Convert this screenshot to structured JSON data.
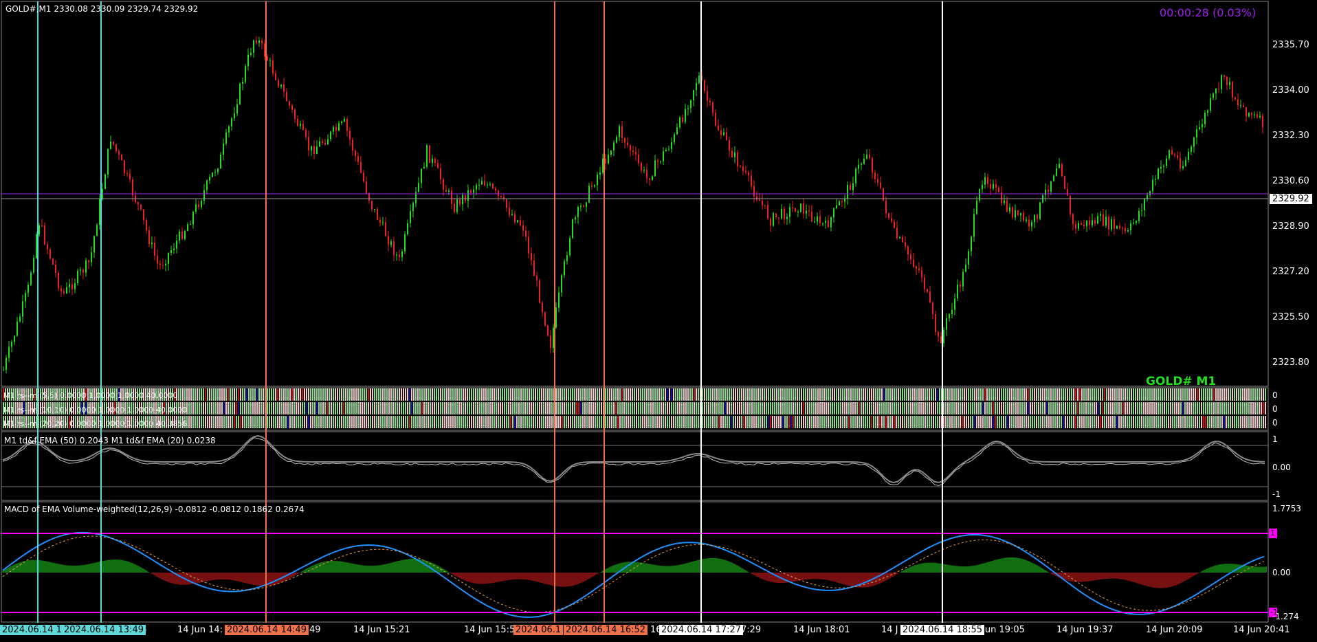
{
  "symbol_info": "GOLD#,M1  2330.08 2330.09 2329.74 2329.92",
  "timer": "00:00:28 (0.03%)",
  "watermark": "GOLD# M1",
  "current_price": "2329.92",
  "price_axis": [
    "2335.70",
    "2334.00",
    "2332.30",
    "2330.60",
    "2328.90",
    "2327.20",
    "2325.50",
    "2323.80"
  ],
  "strip_labels": [
    "M1 rs--m (5,5) 0.0000  1.0000  1.0000 40.0000",
    "M1 rs--m (10,10) 0.0000  1.0000  1.0000 40.0000",
    "M1 rs--m (20,20) 0.0000  1.0000  1.0000 40.3856"
  ],
  "strip_axis": [
    "0",
    "0",
    "0"
  ],
  "osc": {
    "label": "M1 td&f EMA (50) 0.2043  M1 td&f EMA (20) 0.0238",
    "axis": [
      "1",
      "0.00",
      "-1"
    ]
  },
  "macd": {
    "label": "MACD of EMA Volume-weighted(12,26,9) -0.0812 -0.0812 0.1862 0.2674",
    "axis": [
      "1.7753",
      "0.00",
      "-1.274"
    ],
    "marker_top": "1",
    "marker_bottom": "-1"
  },
  "time_axis": [
    "14 Jun 14:",
    "49",
    "14 Jun 15:21",
    "14 Jun 15:53",
    "16",
    "7:29",
    "14 Jun 18:01",
    "14 J",
    "Jun 19:05",
    "14 Jun 19:37",
    "14 Jun 20:09",
    "14 Jun 20:41",
    "6"
  ],
  "time_tags": [
    {
      "text": "2024.06.14 1:",
      "bg": "#5ed8d8",
      "fg": "#000"
    },
    {
      "text": "2024.06.14 13:49",
      "bg": "#5ed8d8",
      "fg": "#000"
    },
    {
      "text": "2024.06.14 14:49",
      "bg": "#f0704a",
      "fg": "#000"
    },
    {
      "text": "2024.06.1",
      "bg": "#f0704a",
      "fg": "#000"
    },
    {
      "text": "2024.06.14 16:52",
      "bg": "#f0704a",
      "fg": "#000"
    },
    {
      "text": "2024.06.14 17:27",
      "bg": "#ffffff",
      "fg": "#000"
    },
    {
      "text": "2024.06.14 18:55",
      "bg": "#ffffff",
      "fg": "#000"
    }
  ],
  "colors": {
    "bull": "#22dd22",
    "bear": "#ee2222",
    "cyan": "#5ed8d8",
    "orange": "#f0704a",
    "magenta": "#ff00ff",
    "timer": "#a020f0",
    "watermark": "#22dd22",
    "blue": "#1e90ff"
  }
}
